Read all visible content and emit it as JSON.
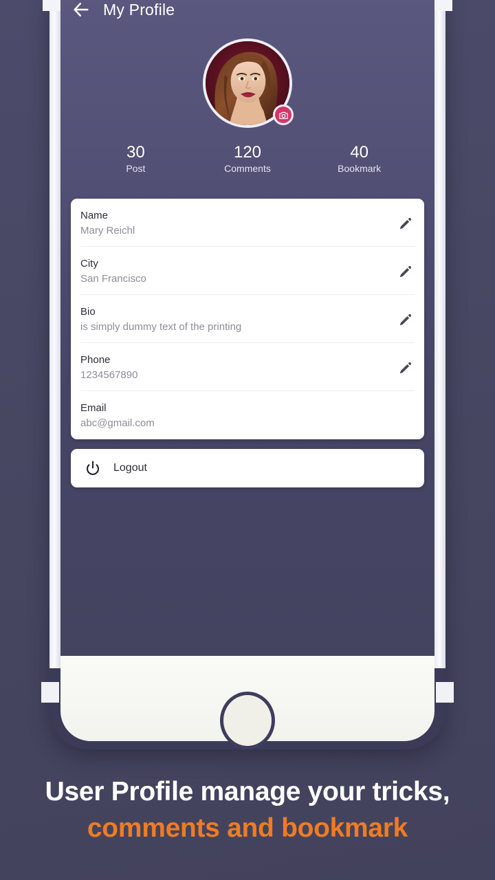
{
  "header": {
    "title": "My Profile",
    "back_icon": "arrow-left-icon"
  },
  "avatar": {
    "icon": "user-avatar-photo",
    "camera_badge_icon": "camera-icon"
  },
  "stats": [
    {
      "value": "30",
      "label": "Post"
    },
    {
      "value": "120",
      "label": "Comments"
    },
    {
      "value": "40",
      "label": "Bookmark"
    }
  ],
  "profile_fields": [
    {
      "label": "Name",
      "value": "Mary Reichl",
      "editable": true,
      "edit_icon": "pencil-icon"
    },
    {
      "label": "City",
      "value": "San Francisco",
      "editable": true,
      "edit_icon": "pencil-icon"
    },
    {
      "label": "Bio",
      "value": "is simply dummy text of the printing",
      "editable": true,
      "edit_icon": "pencil-icon"
    },
    {
      "label": "Phone",
      "value": "1234567890",
      "editable": true,
      "edit_icon": "pencil-icon"
    },
    {
      "label": "Email",
      "value": "abc@gmail.com",
      "editable": false,
      "edit_icon": ""
    }
  ],
  "logout": {
    "label": "Logout",
    "icon": "power-icon"
  },
  "caption": {
    "line1": "User Profile manage your tricks,",
    "line2": "comments and bookmark"
  },
  "colors": {
    "screen_top": "#5a587e",
    "screen_bottom": "#444360",
    "backdrop": "#474762",
    "card": "#ffffff",
    "accent_orange": "#ef7c22",
    "badge_pink": "#d6346a",
    "device_frame": "#3b3a57"
  }
}
